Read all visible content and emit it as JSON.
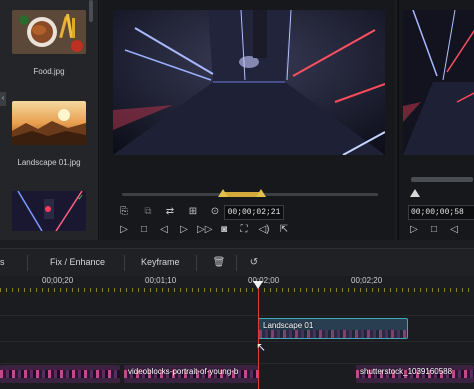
{
  "media": {
    "items": [
      {
        "label": "Food.jpg"
      },
      {
        "label": "Landscape 01.jpg"
      },
      {
        "label": ""
      }
    ],
    "collapse_glyph": "‹"
  },
  "source_viewer": {
    "timecode": "00;00;02;21",
    "range_color": "#d4a83a"
  },
  "program_viewer": {
    "timecode": "00;00;00;58"
  },
  "toolbar": {
    "partial_label": "s",
    "fix_enhance": "Fix / Enhance",
    "keyframe": "Keyframe"
  },
  "ruler": {
    "labels": [
      "00;00;20",
      "00;01;10",
      "00;02;00",
      "00;02;20"
    ]
  },
  "tracks": {
    "overlay_clip": "Landscape 01",
    "main_clips": [
      "",
      "videoblocks-portrait-of-young-b",
      "shutterstock_1039160588"
    ]
  },
  "colors": {
    "accent": "#d4a83a",
    "playhead": "#e23b3b",
    "clip_border": "#3fa8b8"
  },
  "icons": {
    "play": "play-icon",
    "stop": "stop-icon",
    "prev-frame": "prev-frame-icon",
    "next-frame": "next-frame-icon",
    "snapshot": "camera-icon",
    "volume": "volume-icon"
  }
}
